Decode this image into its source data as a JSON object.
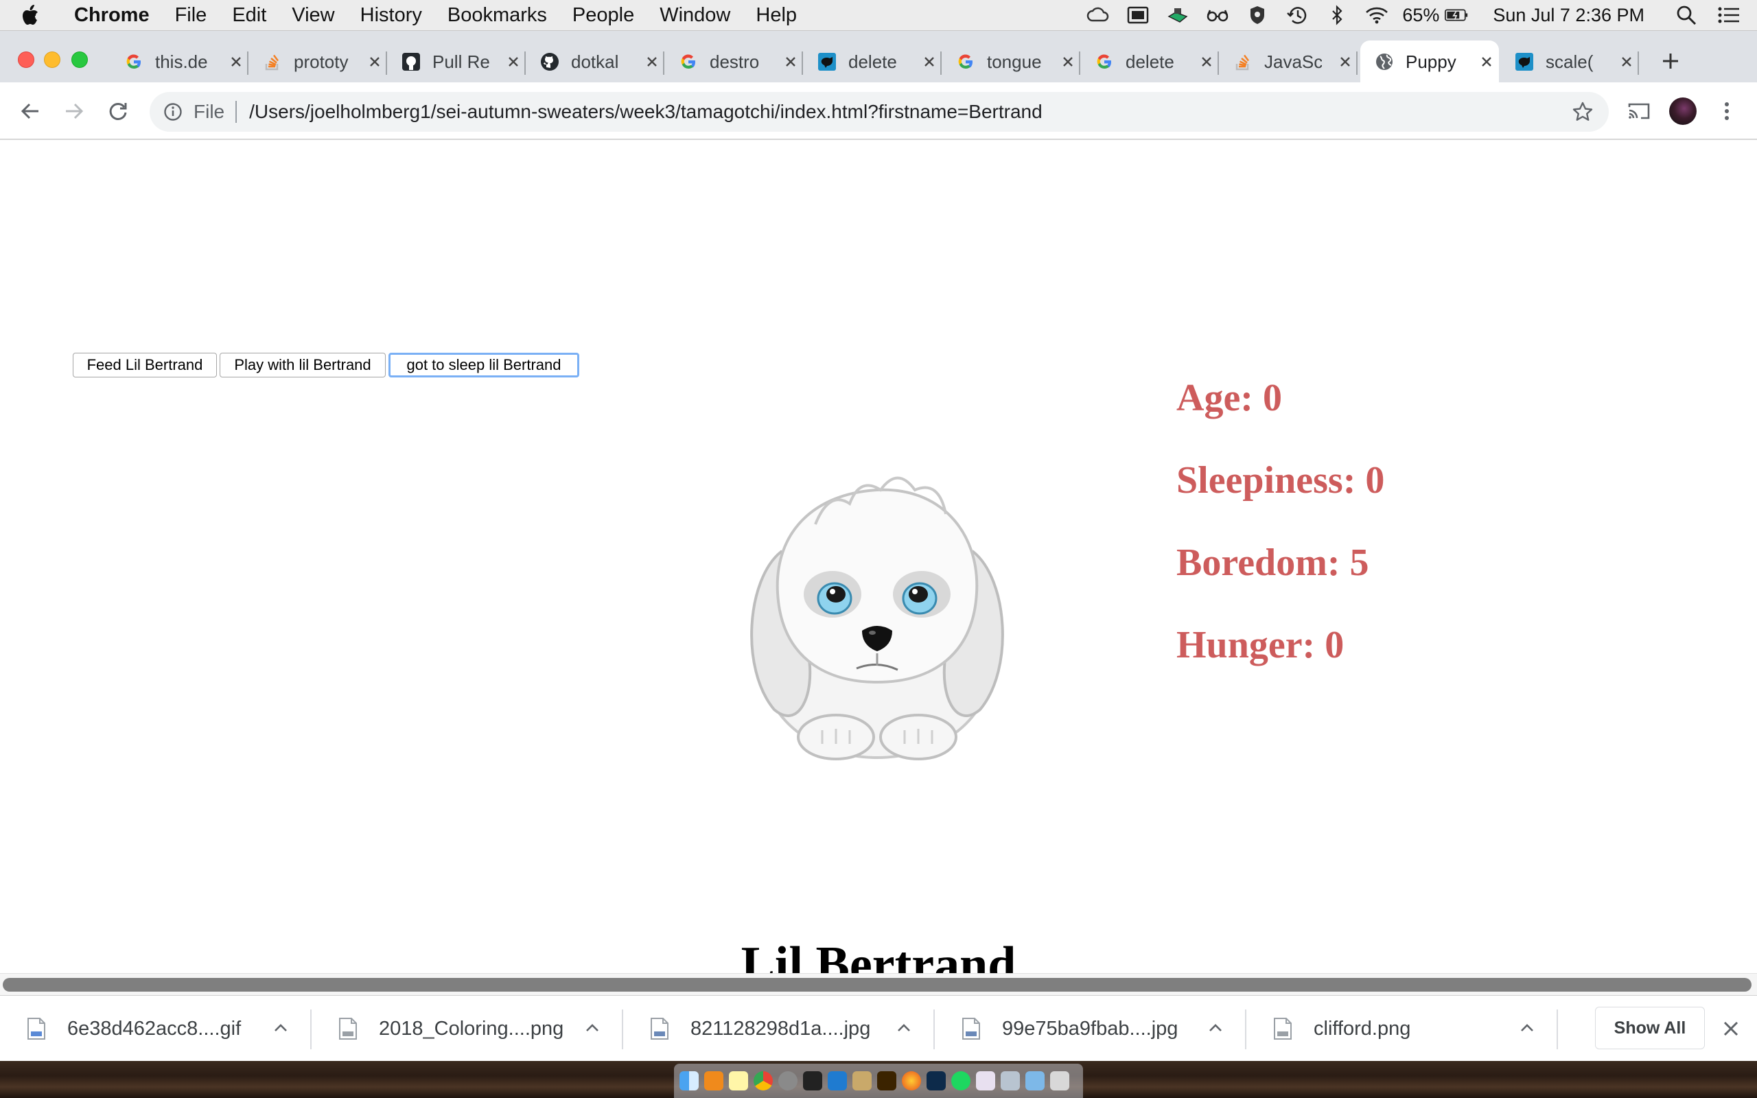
{
  "menubar": {
    "app_name": "Chrome",
    "menus": [
      "File",
      "Edit",
      "View",
      "History",
      "Bookmarks",
      "People",
      "Window",
      "Help"
    ],
    "battery": "65%",
    "clock": "Sun Jul 7  2:36 PM",
    "status_icons": [
      "creative-cloud-icon",
      "display-icon",
      "dropbox-icon",
      "glasses-icon",
      "vpn-shield-icon",
      "time-machine-icon",
      "bluetooth-icon",
      "wifi-icon",
      "battery-icon",
      "spotlight-icon",
      "notification-center-icon"
    ]
  },
  "tabs": [
    {
      "title": "this.de",
      "icon": "google-icon"
    },
    {
      "title": "prototy",
      "icon": "stackoverflow-icon"
    },
    {
      "title": "Pull Re",
      "icon": "github-square-icon"
    },
    {
      "title": "dotkal",
      "icon": "github-icon"
    },
    {
      "title": "destro",
      "icon": "google-icon"
    },
    {
      "title": "delete",
      "icon": "codepen-dog-icon"
    },
    {
      "title": "tongue",
      "icon": "google-icon"
    },
    {
      "title": "delete",
      "icon": "google-icon"
    },
    {
      "title": "JavaSc",
      "icon": "stackoverflow-icon"
    },
    {
      "title": "Puppy",
      "icon": "globe-icon",
      "active": true
    },
    {
      "title": "scale(",
      "icon": "codepen-dog-icon"
    }
  ],
  "toolbar": {
    "scheme": "File",
    "url": "/Users/joelholmberg1/sei-autumn-sweaters/week3/tamagotchi/index.html?firstname=Bertrand"
  },
  "page": {
    "buttons": {
      "feed": "Feed Lil Bertrand",
      "play": "Play with lil Bertrand",
      "sleep": "got to sleep lil Bertrand"
    },
    "pet_name": "Lil Bertrand",
    "stats": [
      {
        "label": "Age: 0"
      },
      {
        "label": "Sleepiness: 0"
      },
      {
        "label": "Boredom: 5"
      },
      {
        "label": "Hunger: 0"
      }
    ],
    "stat_color": "#cd5c5c"
  },
  "downloads": {
    "items": [
      {
        "name": "6e38d462acc8....gif",
        "type": "GIF"
      },
      {
        "name": "2018_Coloring....png",
        "type": "PNG"
      },
      {
        "name": "821128298d1a....jpg",
        "type": "JPEG"
      },
      {
        "name": "99e75ba9fbab....jpg",
        "type": "JPEG"
      },
      {
        "name": "clifford.png",
        "type": "PNG"
      }
    ],
    "show_all": "Show All"
  }
}
